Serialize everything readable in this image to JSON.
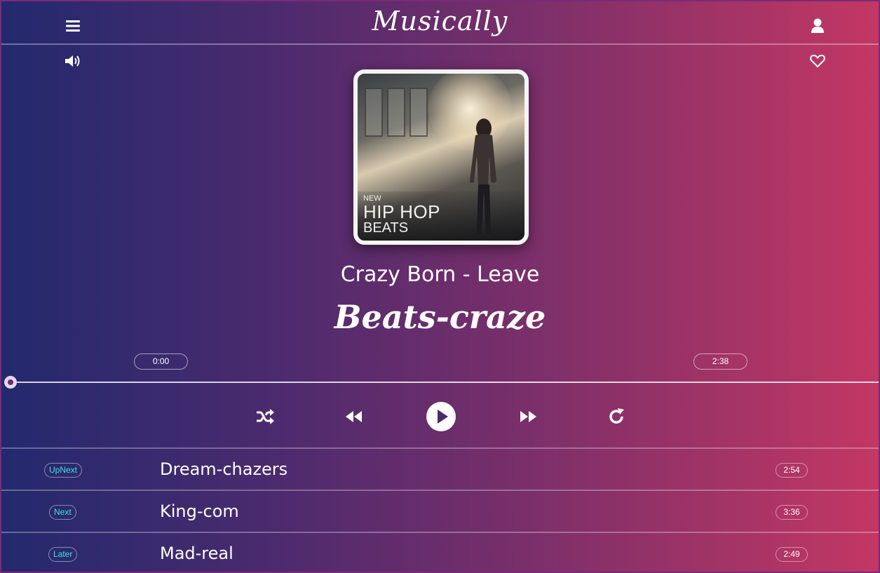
{
  "header": {
    "brand": "Musically",
    "menu_icon": "menu-icon",
    "user_icon": "user-icon"
  },
  "toolbar": {
    "volume_icon": "volume-icon",
    "favorite_icon": "heart-icon"
  },
  "now_playing": {
    "cover": {
      "new_label": "NEW",
      "title_label": "HIP HOP",
      "beats_label": "BEATS"
    },
    "song_title": "Crazy Born - Leave",
    "artist": "Beats-craze",
    "time_current": "0:00",
    "time_total": "2:38",
    "progress": 0
  },
  "controls": {
    "shuffle": "shuffle-icon",
    "previous": "rewind-icon",
    "play": "play-icon",
    "next": "fast-forward-icon",
    "repeat": "repeat-icon"
  },
  "queue": [
    {
      "badge": "UpNext",
      "name": "Dream-chazers",
      "duration": "2:54"
    },
    {
      "badge": "Next",
      "name": "King-com",
      "duration": "3:36"
    },
    {
      "badge": "Later",
      "name": "Mad-real",
      "duration": "2:49"
    }
  ],
  "colors": {
    "gradient_start": "#23296e",
    "gradient_end": "#c33763",
    "badge_text": "#3fe3e0"
  }
}
